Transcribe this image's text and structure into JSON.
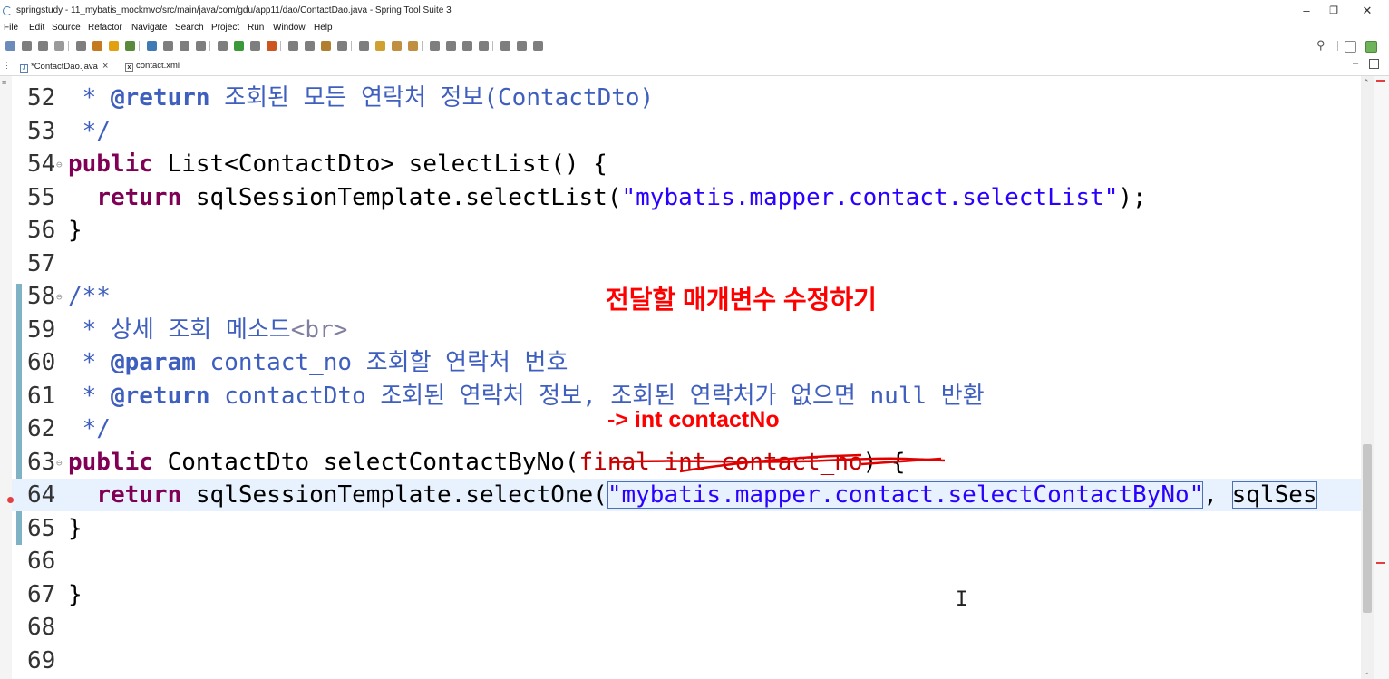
{
  "window": {
    "title": "springstudy - 11_mybatis_mockmvc/src/main/java/com/gdu/app11/dao/ContactDao.java - Spring Tool Suite 3",
    "minimize_glyph": "–",
    "restore_glyph": "❐",
    "close_glyph": "✕"
  },
  "menu": [
    "File",
    "Edit",
    "Source",
    "Refactor",
    "Navigate",
    "Search",
    "Project",
    "Run",
    "Window",
    "Help"
  ],
  "tabs": [
    {
      "label": "*ContactDao.java",
      "icon": "J",
      "close": "×"
    },
    {
      "label": "contact.xml",
      "icon": "x"
    }
  ],
  "editor": {
    "lines": [
      {
        "n": "52",
        "fold": "",
        "parts": [
          {
            "t": " * ",
            "c": "cm"
          },
          {
            "t": "@return",
            "c": "tag"
          },
          {
            "t": " 조회된 모든 연락처 정보(ContactDto)",
            "c": "cm"
          }
        ]
      },
      {
        "n": "53",
        "fold": "",
        "parts": [
          {
            "t": " */",
            "c": "cm"
          }
        ]
      },
      {
        "n": "54",
        "fold": "⊖",
        "parts": [
          {
            "t": "public",
            "c": "kw"
          },
          {
            "t": " List<ContactDto> selectList() {",
            "c": ""
          }
        ]
      },
      {
        "n": "55",
        "fold": "",
        "parts": [
          {
            "t": "  ",
            "c": ""
          },
          {
            "t": "return",
            "c": "kw"
          },
          {
            "t": " sqlSessionTemplate.selectList(",
            "c": ""
          },
          {
            "t": "\"mybatis.mapper.contact.selectList\"",
            "c": "str"
          },
          {
            "t": ");",
            "c": ""
          }
        ]
      },
      {
        "n": "56",
        "fold": "",
        "parts": [
          {
            "t": "}",
            "c": ""
          }
        ]
      },
      {
        "n": "57",
        "fold": "",
        "parts": []
      },
      {
        "n": "58",
        "fold": "⊖",
        "parts": [
          {
            "t": "/**",
            "c": "cm"
          }
        ]
      },
      {
        "n": "59",
        "fold": "",
        "parts": [
          {
            "t": " * 상세 조회 메소드",
            "c": "cm"
          },
          {
            "t": "<br>",
            "c": "html"
          }
        ]
      },
      {
        "n": "60",
        "fold": "",
        "parts": [
          {
            "t": " * ",
            "c": "cm"
          },
          {
            "t": "@param",
            "c": "tag"
          },
          {
            "t": " contact_no 조회할 연락처 번호",
            "c": "cm"
          }
        ]
      },
      {
        "n": "61",
        "fold": "",
        "parts": [
          {
            "t": " * ",
            "c": "cm"
          },
          {
            "t": "@return",
            "c": "tag"
          },
          {
            "t": " contactDto 조회된 연락처 정보, 조회된 연락처가 없으면 null 반환",
            "c": "cm"
          }
        ]
      },
      {
        "n": "62",
        "fold": "",
        "parts": [
          {
            "t": " */",
            "c": "cm"
          }
        ]
      },
      {
        "n": "63",
        "fold": "⊖",
        "parts": [
          {
            "t": "public",
            "c": "kw"
          },
          {
            "t": " ContactDto selectContactByNo(",
            "c": ""
          },
          {
            "t": "final int contact_no",
            "c": "strike"
          },
          {
            "t": ") {",
            "c": ""
          }
        ]
      },
      {
        "n": "64",
        "fold": "",
        "current": true,
        "parts": [
          {
            "t": "  ",
            "c": ""
          },
          {
            "t": "return",
            "c": "kw"
          },
          {
            "t": " sqlSessionTemplate.selectOne(",
            "c": ""
          },
          {
            "t": "\"mybatis.mapper.contact.selectContactByNo\"",
            "c": "str sel"
          },
          {
            "t": ", ",
            "c": ""
          },
          {
            "t": "sqlSes",
            "c": "sel"
          }
        ]
      },
      {
        "n": "65",
        "fold": "",
        "parts": [
          {
            "t": "}",
            "c": ""
          }
        ]
      },
      {
        "n": "66",
        "fold": "",
        "parts": []
      },
      {
        "n": "67",
        "fold": "",
        "parts": [
          {
            "t": "}",
            "c": ""
          }
        ]
      },
      {
        "n": "68",
        "fold": "",
        "parts": []
      },
      {
        "n": "69",
        "fold": "",
        "parts": []
      }
    ]
  },
  "annotations": {
    "heading": "전달할 매개변수 수정하기",
    "replacement": "-> int contactNo"
  },
  "colors": {
    "keyword": "#7f0055",
    "comment": "#3f5fbf",
    "string": "#2a00ff",
    "annotation": "#ff0000",
    "current_line": "#e8f2fe"
  },
  "icons": {
    "app": "spring-tool-suite-icon",
    "search": "search-icon",
    "perspective": "perspective-icon"
  }
}
